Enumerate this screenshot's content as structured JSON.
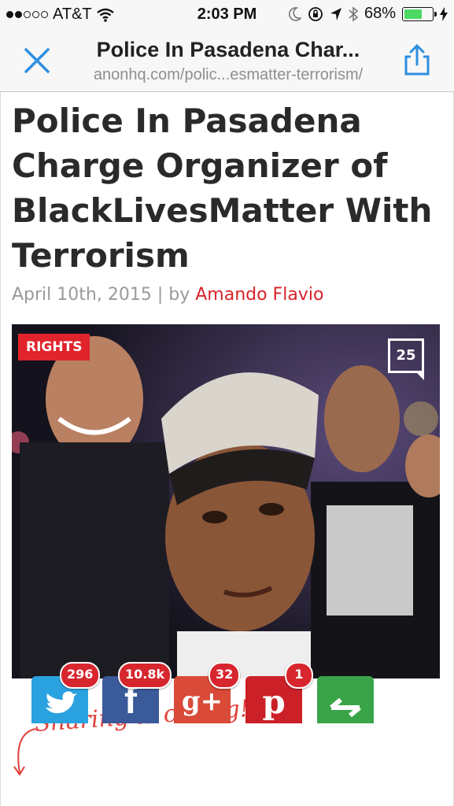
{
  "status_bar": {
    "carrier": "AT&T",
    "time": "2:03 PM",
    "battery": "68%",
    "battery_level": 0.68,
    "signal_bars_filled": 2,
    "signal_bars_total": 5
  },
  "browser": {
    "title": "Police In Pasadena Char...",
    "url": "anonhq.com/polic...esmatter-terrorism/",
    "accent_color": "#2f8fe0"
  },
  "article": {
    "headline": "Police In Pasadena Charge Organizer of BlackLivesMatter With Terrorism",
    "date": "April 10th, 2015",
    "separator": "|",
    "by": "by",
    "author": "Amando Flavio",
    "category": "RIGHTS",
    "comments_count": "25"
  },
  "sharing": {
    "tagline": "Sharing is caring!",
    "buttons": [
      {
        "network": "twitter",
        "icon": "twitter-icon",
        "count": "296",
        "color": "#2aa2e0"
      },
      {
        "network": "facebook",
        "icon": "facebook-icon",
        "count": "10.8k",
        "color": "#3b5a9a"
      },
      {
        "network": "google-plus",
        "icon": "google-plus-icon",
        "count": "32",
        "color": "#d94a38"
      },
      {
        "network": "pinterest",
        "icon": "pinterest-icon",
        "count": "1",
        "color": "#cb2027"
      },
      {
        "network": "sharethis",
        "icon": "share-icon",
        "count": "",
        "color": "#3aa548"
      }
    ]
  }
}
